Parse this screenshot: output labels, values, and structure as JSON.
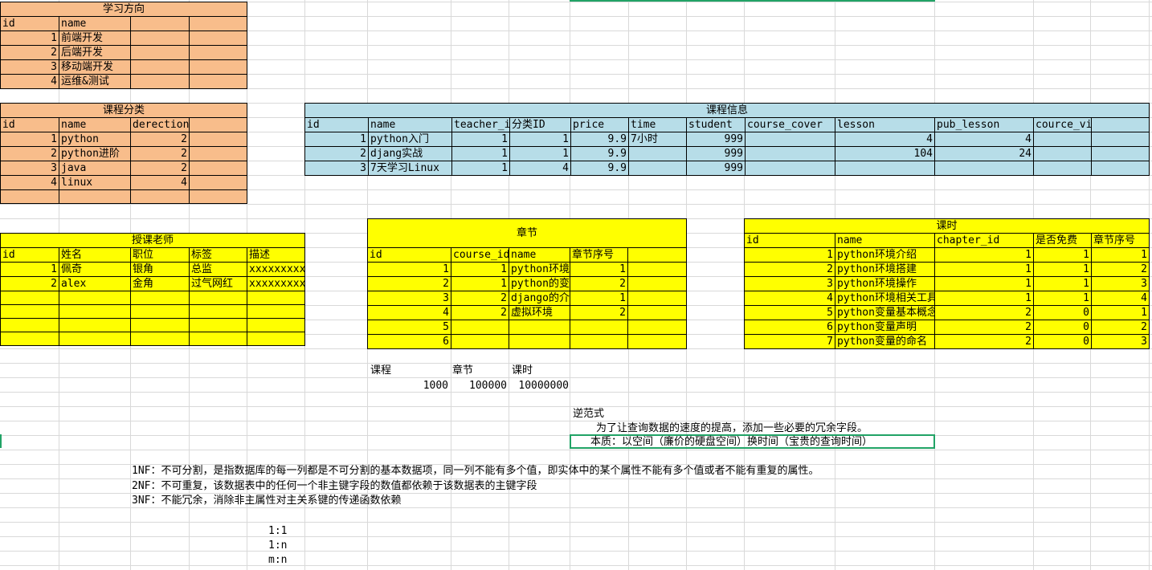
{
  "direction_table": {
    "title": "学习方向",
    "headers": [
      "id",
      "name",
      "",
      ""
    ],
    "rows": [
      [
        "1",
        "前端开发",
        "",
        ""
      ],
      [
        "2",
        "后端开发",
        "",
        ""
      ],
      [
        "3",
        "移动端开发",
        "",
        ""
      ],
      [
        "4",
        "运维&测试",
        "",
        ""
      ]
    ]
  },
  "category_table": {
    "title": "课程分类",
    "headers": [
      "id",
      "name",
      "derection",
      ""
    ],
    "rows": [
      [
        "1",
        "python",
        "2",
        ""
      ],
      [
        "2",
        "python进阶",
        "2",
        ""
      ],
      [
        "3",
        "java",
        "2",
        ""
      ],
      [
        "4",
        "linux",
        "4",
        ""
      ],
      [
        "",
        "",
        "",
        ""
      ]
    ]
  },
  "course_table": {
    "title": "课程信息",
    "headers": [
      "id",
      "name",
      "teacher_id",
      "分类ID",
      "price",
      "time",
      "student",
      "course_cover",
      "lesson",
      "pub_lesson",
      "cource_video",
      ""
    ],
    "rows": [
      [
        "1",
        "python入门",
        "1",
        "1",
        "9.9",
        "7小时",
        "999",
        "",
        "4",
        "4",
        "",
        ""
      ],
      [
        "2",
        "djang实战",
        "1",
        "1",
        "9.9",
        "",
        "999",
        "",
        "104",
        "24",
        "",
        ""
      ],
      [
        "3",
        "7天学习Linux",
        "1",
        "4",
        "9.9",
        "",
        "999",
        "",
        "",
        "",
        "",
        ""
      ]
    ]
  },
  "teacher_table": {
    "title": "授课老师",
    "headers": [
      "id",
      "姓名",
      "职位",
      "标签",
      "描述"
    ],
    "rows": [
      [
        "1",
        "佩奇",
        "银角",
        "总监",
        "xxxxxxxxxxxxx"
      ],
      [
        "2",
        "alex",
        "金角",
        "过气网红",
        "xxxxxxxxxxxxx"
      ],
      [
        "",
        "",
        "",
        "",
        ""
      ],
      [
        "",
        "",
        "",
        "",
        ""
      ],
      [
        "",
        "",
        "",
        "",
        ""
      ],
      [
        "",
        "",
        "",
        "",
        ""
      ]
    ]
  },
  "chapter_table": {
    "title": "章节",
    "headers": [
      "id",
      "course_id",
      "name",
      "章节序号",
      ""
    ],
    "rows": [
      [
        "1",
        "1",
        "python环境",
        "1",
        ""
      ],
      [
        "2",
        "1",
        "python的变量",
        "2",
        ""
      ],
      [
        "3",
        "2",
        "django的介绍",
        "1",
        ""
      ],
      [
        "4",
        "2",
        "虚拟环境",
        "2",
        ""
      ],
      [
        "5",
        "",
        "",
        "",
        ""
      ],
      [
        "6",
        "",
        "",
        "",
        ""
      ]
    ]
  },
  "lesson_table": {
    "title": "课时",
    "headers": [
      "id",
      "name",
      "chapter_id",
      "是否免费",
      "章节序号"
    ],
    "rows": [
      [
        "1",
        "python环境介绍",
        "1",
        "1",
        "1"
      ],
      [
        "2",
        "python环境搭建",
        "1",
        "1",
        "2"
      ],
      [
        "3",
        "python环境操作",
        "1",
        "1",
        "3"
      ],
      [
        "4",
        "python环境相关工具",
        "1",
        "1",
        "4"
      ],
      [
        "5",
        "python变量基本概念",
        "2",
        "0",
        "1"
      ],
      [
        "6",
        "python变量声明",
        "2",
        "0",
        "2"
      ],
      [
        "7",
        "python变量的命名",
        "2",
        "0",
        "3"
      ]
    ]
  },
  "counts": {
    "labels": [
      "课程",
      "章节",
      "课时"
    ],
    "values": [
      "1000",
      "100000",
      "10000000"
    ]
  },
  "notes": {
    "denorm_title": "逆范式",
    "denorm_line1": "为了让查询数据的速度的提高，添加一些必要的冗余字段。",
    "denorm_line2": "本质：以空间（廉价的硬盘空间）换时间（宝贵的查询时间）",
    "nf1": "1NF：不可分割，是指数据库的每一列都是不可分割的基本数据项，同一列不能有多个值，即实体中的某个属性不能有多个值或者不能有重复的属性。",
    "nf2": "2NF：不可重复，该数据表中的任何一个非主键字段的数值都依赖于该数据表的主键字段",
    "nf3": "3NF：不能冗余，消除非主属性对主关系键的传递函数依赖",
    "rel1": "1:1",
    "rel2": "1:n",
    "rel3": "m:n"
  },
  "colors": {
    "orange": "#f8bd8b",
    "blue": "#b7dde8",
    "yellow": "#ffff00",
    "selection": "#21a366"
  }
}
